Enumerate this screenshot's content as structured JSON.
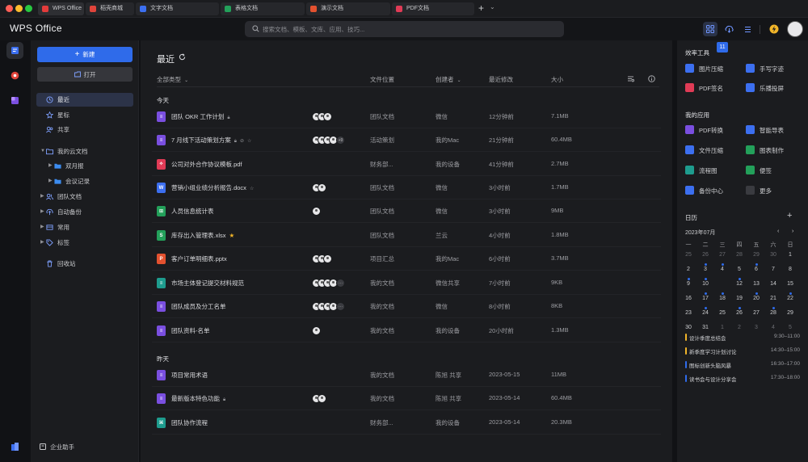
{
  "tabs": [
    {
      "label": "WPS Office",
      "color": "#e23b3b"
    },
    {
      "label": "稻壳商城",
      "color": "#e0443b"
    },
    {
      "label": "文字文档",
      "color": "#3c6ff0"
    },
    {
      "label": "表格文档",
      "color": "#23a05a"
    },
    {
      "label": "演示文档",
      "color": "#e3512f"
    },
    {
      "label": "PDF文档",
      "color": "#e03b56"
    }
  ],
  "tab_plus": "+",
  "tab_dropdown": "⌄",
  "header": {
    "logo": "WPS Office",
    "search_placeholder": "搜索文档、模板、文库、应用、技巧..."
  },
  "sidebar": {
    "new_label": "新建",
    "open_label": "打开",
    "nav": [
      {
        "label": "最近",
        "icon": "clock-icon"
      },
      {
        "label": "星标",
        "icon": "star-icon"
      },
      {
        "label": "共享",
        "icon": "share-icon"
      },
      {
        "label": "我的云文档",
        "icon": "cloud-folder-icon"
      },
      {
        "label": "双月报",
        "icon": "folder-icon"
      },
      {
        "label": "会议记录",
        "icon": "folder-icon"
      },
      {
        "label": "团队文档",
        "icon": "team-icon"
      },
      {
        "label": "自动备份",
        "icon": "backup-icon"
      },
      {
        "label": "常用",
        "icon": "frequent-icon"
      },
      {
        "label": "标签",
        "icon": "tag-icon"
      },
      {
        "label": "回收站",
        "icon": "trash-icon"
      }
    ],
    "assistant_label": "企业助手"
  },
  "main": {
    "title": "最近",
    "columns": {
      "type_filter": "全部类型",
      "location": "文件位置",
      "creator": "创建者",
      "modified": "最近修改",
      "size": "大小"
    },
    "groups": [
      {
        "label": "今天"
      },
      {
        "label": "昨天"
      }
    ],
    "files": [
      {
        "name": "团队 OKR 工作计划",
        "kind": "doc",
        "color": "#7a4fe0",
        "glyph": "≡",
        "lock": true,
        "collab": "",
        "star_outline": false,
        "star": false,
        "avatars": 3,
        "more": "",
        "location": "团队文档",
        "creator": "微信",
        "modified": "12分钟前",
        "size": "7.1MB"
      },
      {
        "name": "7 月线下活动策划方案",
        "kind": "doc",
        "color": "#7a4fe0",
        "glyph": "≡",
        "lock": true,
        "collab": "⊘",
        "star_outline": true,
        "star": false,
        "avatars": 4,
        "more": "+9",
        "location": "活动策划",
        "creator": "我的Mac",
        "modified": "21分钟前",
        "size": "60.4MB"
      },
      {
        "name": "公司对外合作协议模板.pdf",
        "kind": "pdf",
        "color": "#e03b56",
        "glyph": "⟡",
        "lock": false,
        "collab": "",
        "star_outline": false,
        "star": false,
        "avatars": 0,
        "more": "",
        "location": "财务部...",
        "creator": "我的设备",
        "modified": "41分钟前",
        "size": "2.7MB"
      },
      {
        "name": "营销小组业绩分析报告.docx",
        "kind": "word",
        "color": "#3c6ff0",
        "glyph": "W",
        "lock": false,
        "collab": "",
        "star_outline": true,
        "star": false,
        "avatars": 2,
        "more": "",
        "location": "团队文档",
        "creator": "微信",
        "modified": "3小时前",
        "size": "1.7MB"
      },
      {
        "name": "人员信息统计表",
        "kind": "sheet",
        "color": "#23a05a",
        "glyph": "⊞",
        "lock": false,
        "collab": "",
        "star_outline": false,
        "star": false,
        "avatars": 1,
        "more": "",
        "location": "团队文档",
        "creator": "微信",
        "modified": "3小时前",
        "size": "9MB"
      },
      {
        "name": "库存出入管理表.xlsx",
        "kind": "excel",
        "color": "#23a05a",
        "glyph": "S",
        "lock": false,
        "collab": "",
        "star_outline": false,
        "star": true,
        "avatars": 0,
        "more": "",
        "location": "团队文档",
        "creator": "兰云",
        "modified": "4小时前",
        "size": "1.8MB"
      },
      {
        "name": "客户订单明细表.pptx",
        "kind": "ppt",
        "color": "#e3512f",
        "glyph": "P",
        "lock": false,
        "collab": "",
        "star_outline": false,
        "star": false,
        "avatars": 3,
        "more": "",
        "location": "项目汇总",
        "creator": "我的Mac",
        "modified": "6小时前",
        "size": "3.7MB"
      },
      {
        "name": "市场主体登记提交材料规范",
        "kind": "form",
        "color": "#1e9c8e",
        "glyph": "≡",
        "lock": false,
        "collab": "",
        "star_outline": false,
        "star": false,
        "avatars": 4,
        "more": "···",
        "location": "我的文档",
        "creator": "微信共享",
        "modified": "7小时前",
        "size": "9KB"
      },
      {
        "name": "团队成员及分工名单",
        "kind": "doc",
        "color": "#7a4fe0",
        "glyph": "≡",
        "lock": false,
        "collab": "",
        "star_outline": false,
        "star": false,
        "avatars": 4,
        "more": "···",
        "location": "我的文档",
        "creator": "微信",
        "modified": "8小时前",
        "size": "8KB"
      },
      {
        "name": "团队资料-名单",
        "kind": "doc",
        "color": "#7a4fe0",
        "glyph": "≡",
        "lock": false,
        "collab": "",
        "star_outline": false,
        "star": false,
        "avatars": 1,
        "more": "",
        "location": "我的文档",
        "creator": "我的设备",
        "modified": "20小时前",
        "size": "1.3MB"
      },
      {
        "name": "项目常用术语",
        "kind": "doc",
        "color": "#7a4fe0",
        "glyph": "≡",
        "lock": false,
        "collab": "",
        "star_outline": false,
        "star": false,
        "avatars": 0,
        "more": "",
        "location": "我的文档",
        "creator": "陈旭 共享",
        "modified": "2023-05-15",
        "size": "11MB"
      },
      {
        "name": "最新版本特色功能",
        "kind": "doc",
        "color": "#7a4fe0",
        "glyph": "≡",
        "lock": true,
        "collab": "",
        "star_outline": false,
        "star": false,
        "avatars": 2,
        "more": "",
        "location": "我的文档",
        "creator": "陈旭 共享",
        "modified": "2023-05-14",
        "size": "60.4MB"
      },
      {
        "name": "团队协作流程",
        "kind": "flow",
        "color": "#1e9c8e",
        "glyph": "⌘",
        "lock": false,
        "collab": "",
        "star_outline": false,
        "star": false,
        "avatars": 0,
        "more": "",
        "location": "财务部...",
        "creator": "我的设备",
        "modified": "2023-05-14",
        "size": "20.3MB"
      }
    ]
  },
  "right": {
    "tools_title": "效率工具",
    "tools": [
      {
        "label": "图片压缩",
        "color": "#3c6ff0"
      },
      {
        "label": "手写字迹",
        "color": "#3c6ff0"
      },
      {
        "label": "PDF签名",
        "color": "#e03b56"
      },
      {
        "label": "乐播投屏",
        "color": "#3c6ff0"
      }
    ],
    "apps_title": "我的应用",
    "apps": [
      {
        "label": "PDF转换",
        "color": "#7a4fe0"
      },
      {
        "label": "智能导表",
        "color": "#3c6ff0"
      },
      {
        "label": "文件压缩",
        "color": "#3c6ff0"
      },
      {
        "label": "图表制作",
        "color": "#23a05a"
      },
      {
        "label": "流程图",
        "color": "#1e9c8e"
      },
      {
        "label": "便签",
        "color": "#23a05a"
      },
      {
        "label": "备份中心",
        "color": "#3c6ff0"
      },
      {
        "label": "更多",
        "color": "#3a3b40"
      }
    ],
    "calendar": {
      "title": "日历",
      "add": "+",
      "month": "2023年07月",
      "prev": "‹",
      "next": "›",
      "weekdays": [
        "一",
        "二",
        "三",
        "四",
        "五",
        "六",
        "日"
      ],
      "weeks": [
        [
          "25",
          "26",
          "27",
          "28",
          "29",
          "30",
          "1"
        ],
        [
          "2",
          "3",
          "4",
          "5",
          "6",
          "7",
          "8"
        ],
        [
          "9",
          "10",
          "11",
          "12",
          "13",
          "14",
          "15"
        ],
        [
          "16",
          "17",
          "18",
          "19",
          "20",
          "21",
          "22"
        ],
        [
          "23",
          "24",
          "25",
          "26",
          "27",
          "28",
          "29"
        ],
        [
          "30",
          "31",
          "1",
          "2",
          "3",
          "4",
          "5"
        ]
      ],
      "today": "11",
      "events": [
        {
          "title": "设计季度总结会",
          "time": "9:30–11:00",
          "color": "#f0b429"
        },
        {
          "title": "新季度学习计划讨论",
          "time": "14:30–15:00",
          "color": "#f0b429"
        },
        {
          "title": "图标创新头脑风暴",
          "time": "16:30–17:00",
          "color": "#2f6bea"
        },
        {
          "title": "读书会与设计分享会",
          "time": "17:30–18:00",
          "color": "#2f6bea"
        }
      ]
    }
  }
}
